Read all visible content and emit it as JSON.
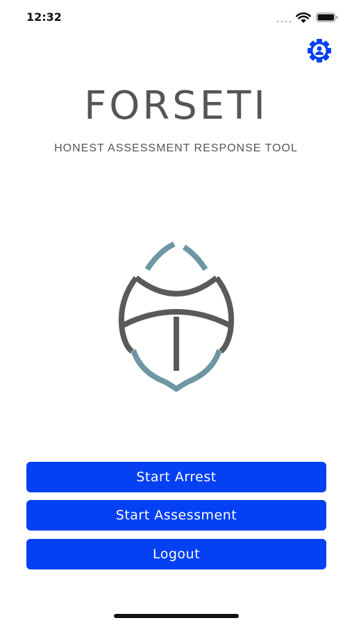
{
  "status_bar": {
    "time": "12:32"
  },
  "header": {
    "settings_icon": "user-gear-icon"
  },
  "branding": {
    "title": "FORSETI",
    "subtitle": "HONEST ASSESSMENT RESPONSE TOOL"
  },
  "actions": {
    "start_arrest": "Start Arrest",
    "start_assessment": "Start Assessment",
    "logout": "Logout"
  },
  "colors": {
    "accent": "#0540f2",
    "title_gray": "#555555",
    "logo_gray": "#5a5a5a",
    "logo_teal": "#6e97a4"
  }
}
